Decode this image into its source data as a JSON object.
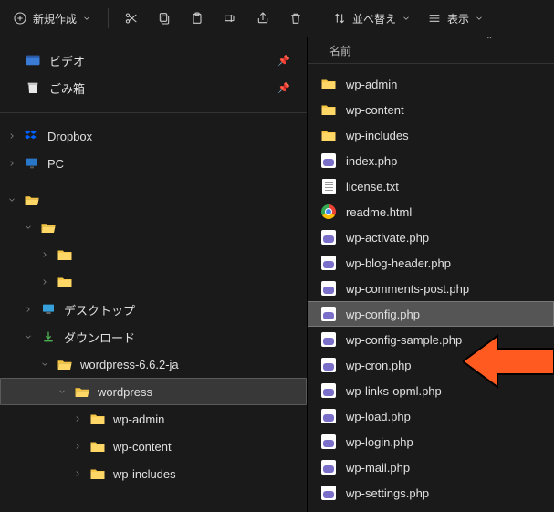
{
  "toolbar": {
    "new": "新規作成",
    "sort": "並べ替え",
    "view": "表示"
  },
  "left": {
    "quick": [
      {
        "label": "ビデオ",
        "icon": "video"
      },
      {
        "label": "ごみ箱",
        "icon": "trash"
      }
    ],
    "roots": [
      {
        "label": "Dropbox",
        "expanded": false,
        "icon": "dropbox",
        "indent": 0
      },
      {
        "label": "PC",
        "expanded": false,
        "icon": "pc",
        "indent": 0
      }
    ],
    "obscured": [
      {
        "expanded": true,
        "indent": 0,
        "color": "net"
      },
      {
        "expanded": true,
        "indent": 1,
        "color": "blue"
      },
      {
        "expanded": false,
        "indent": 2,
        "color": "yel"
      },
      {
        "expanded": false,
        "indent": 2,
        "color": "yel2"
      }
    ],
    "desktop": {
      "label": "デスクトップ",
      "indent": 1
    },
    "downloads": {
      "label": "ダウンロード",
      "indent": 1
    },
    "wp_parent": {
      "label": "wordpress-6.6.2-ja",
      "indent": 2
    },
    "wp": {
      "label": "wordpress",
      "indent": 3,
      "selected": true
    },
    "wp_children": [
      {
        "label": "wp-admin",
        "indent": 4
      },
      {
        "label": "wp-content",
        "indent": 4
      },
      {
        "label": "wp-includes",
        "indent": 4
      }
    ]
  },
  "right": {
    "header": "名前",
    "items": [
      {
        "name": "wp-admin",
        "type": "folder"
      },
      {
        "name": "wp-content",
        "type": "folder"
      },
      {
        "name": "wp-includes",
        "type": "folder"
      },
      {
        "name": "index.php",
        "type": "php"
      },
      {
        "name": "license.txt",
        "type": "txt"
      },
      {
        "name": "readme.html",
        "type": "html"
      },
      {
        "name": "wp-activate.php",
        "type": "php"
      },
      {
        "name": "wp-blog-header.php",
        "type": "php"
      },
      {
        "name": "wp-comments-post.php",
        "type": "php"
      },
      {
        "name": "wp-config.php",
        "type": "php",
        "selected": true
      },
      {
        "name": "wp-config-sample.php",
        "type": "php"
      },
      {
        "name": "wp-cron.php",
        "type": "php"
      },
      {
        "name": "wp-links-opml.php",
        "type": "php"
      },
      {
        "name": "wp-load.php",
        "type": "php"
      },
      {
        "name": "wp-login.php",
        "type": "php"
      },
      {
        "name": "wp-mail.php",
        "type": "php"
      },
      {
        "name": "wp-settings.php",
        "type": "php"
      }
    ]
  }
}
